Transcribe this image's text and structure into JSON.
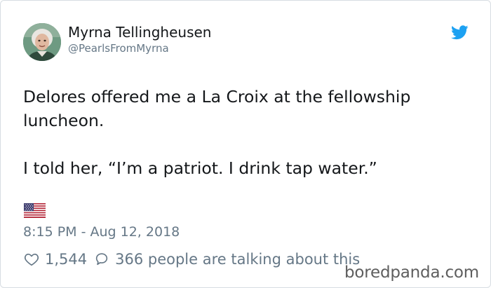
{
  "author": {
    "display_name": "Myrna Tellingheusen",
    "handle": "@PearlsFromMyrna",
    "avatar_icon": "profile-photo-icon"
  },
  "tweet": {
    "paragraph_1": "Delores offered me a La Croix at the fellowship luncheon.",
    "paragraph_2": "I told her, “I’m a patriot. I drink tap water.”",
    "emoji": "us-flag-icon"
  },
  "meta": {
    "timestamp": "8:15 PM - Aug 12, 2018"
  },
  "engagement": {
    "likes": "1,544",
    "talking": "366 people are talking about this",
    "like_icon": "heart-icon",
    "reply_icon": "speech-bubble-icon"
  },
  "branding": {
    "platform_icon": "twitter-bird-icon",
    "watermark": "boredpanda.com"
  },
  "colors": {
    "twitter_blue": "#1da1f2",
    "text_primary": "#14171a",
    "text_secondary": "#657786"
  }
}
